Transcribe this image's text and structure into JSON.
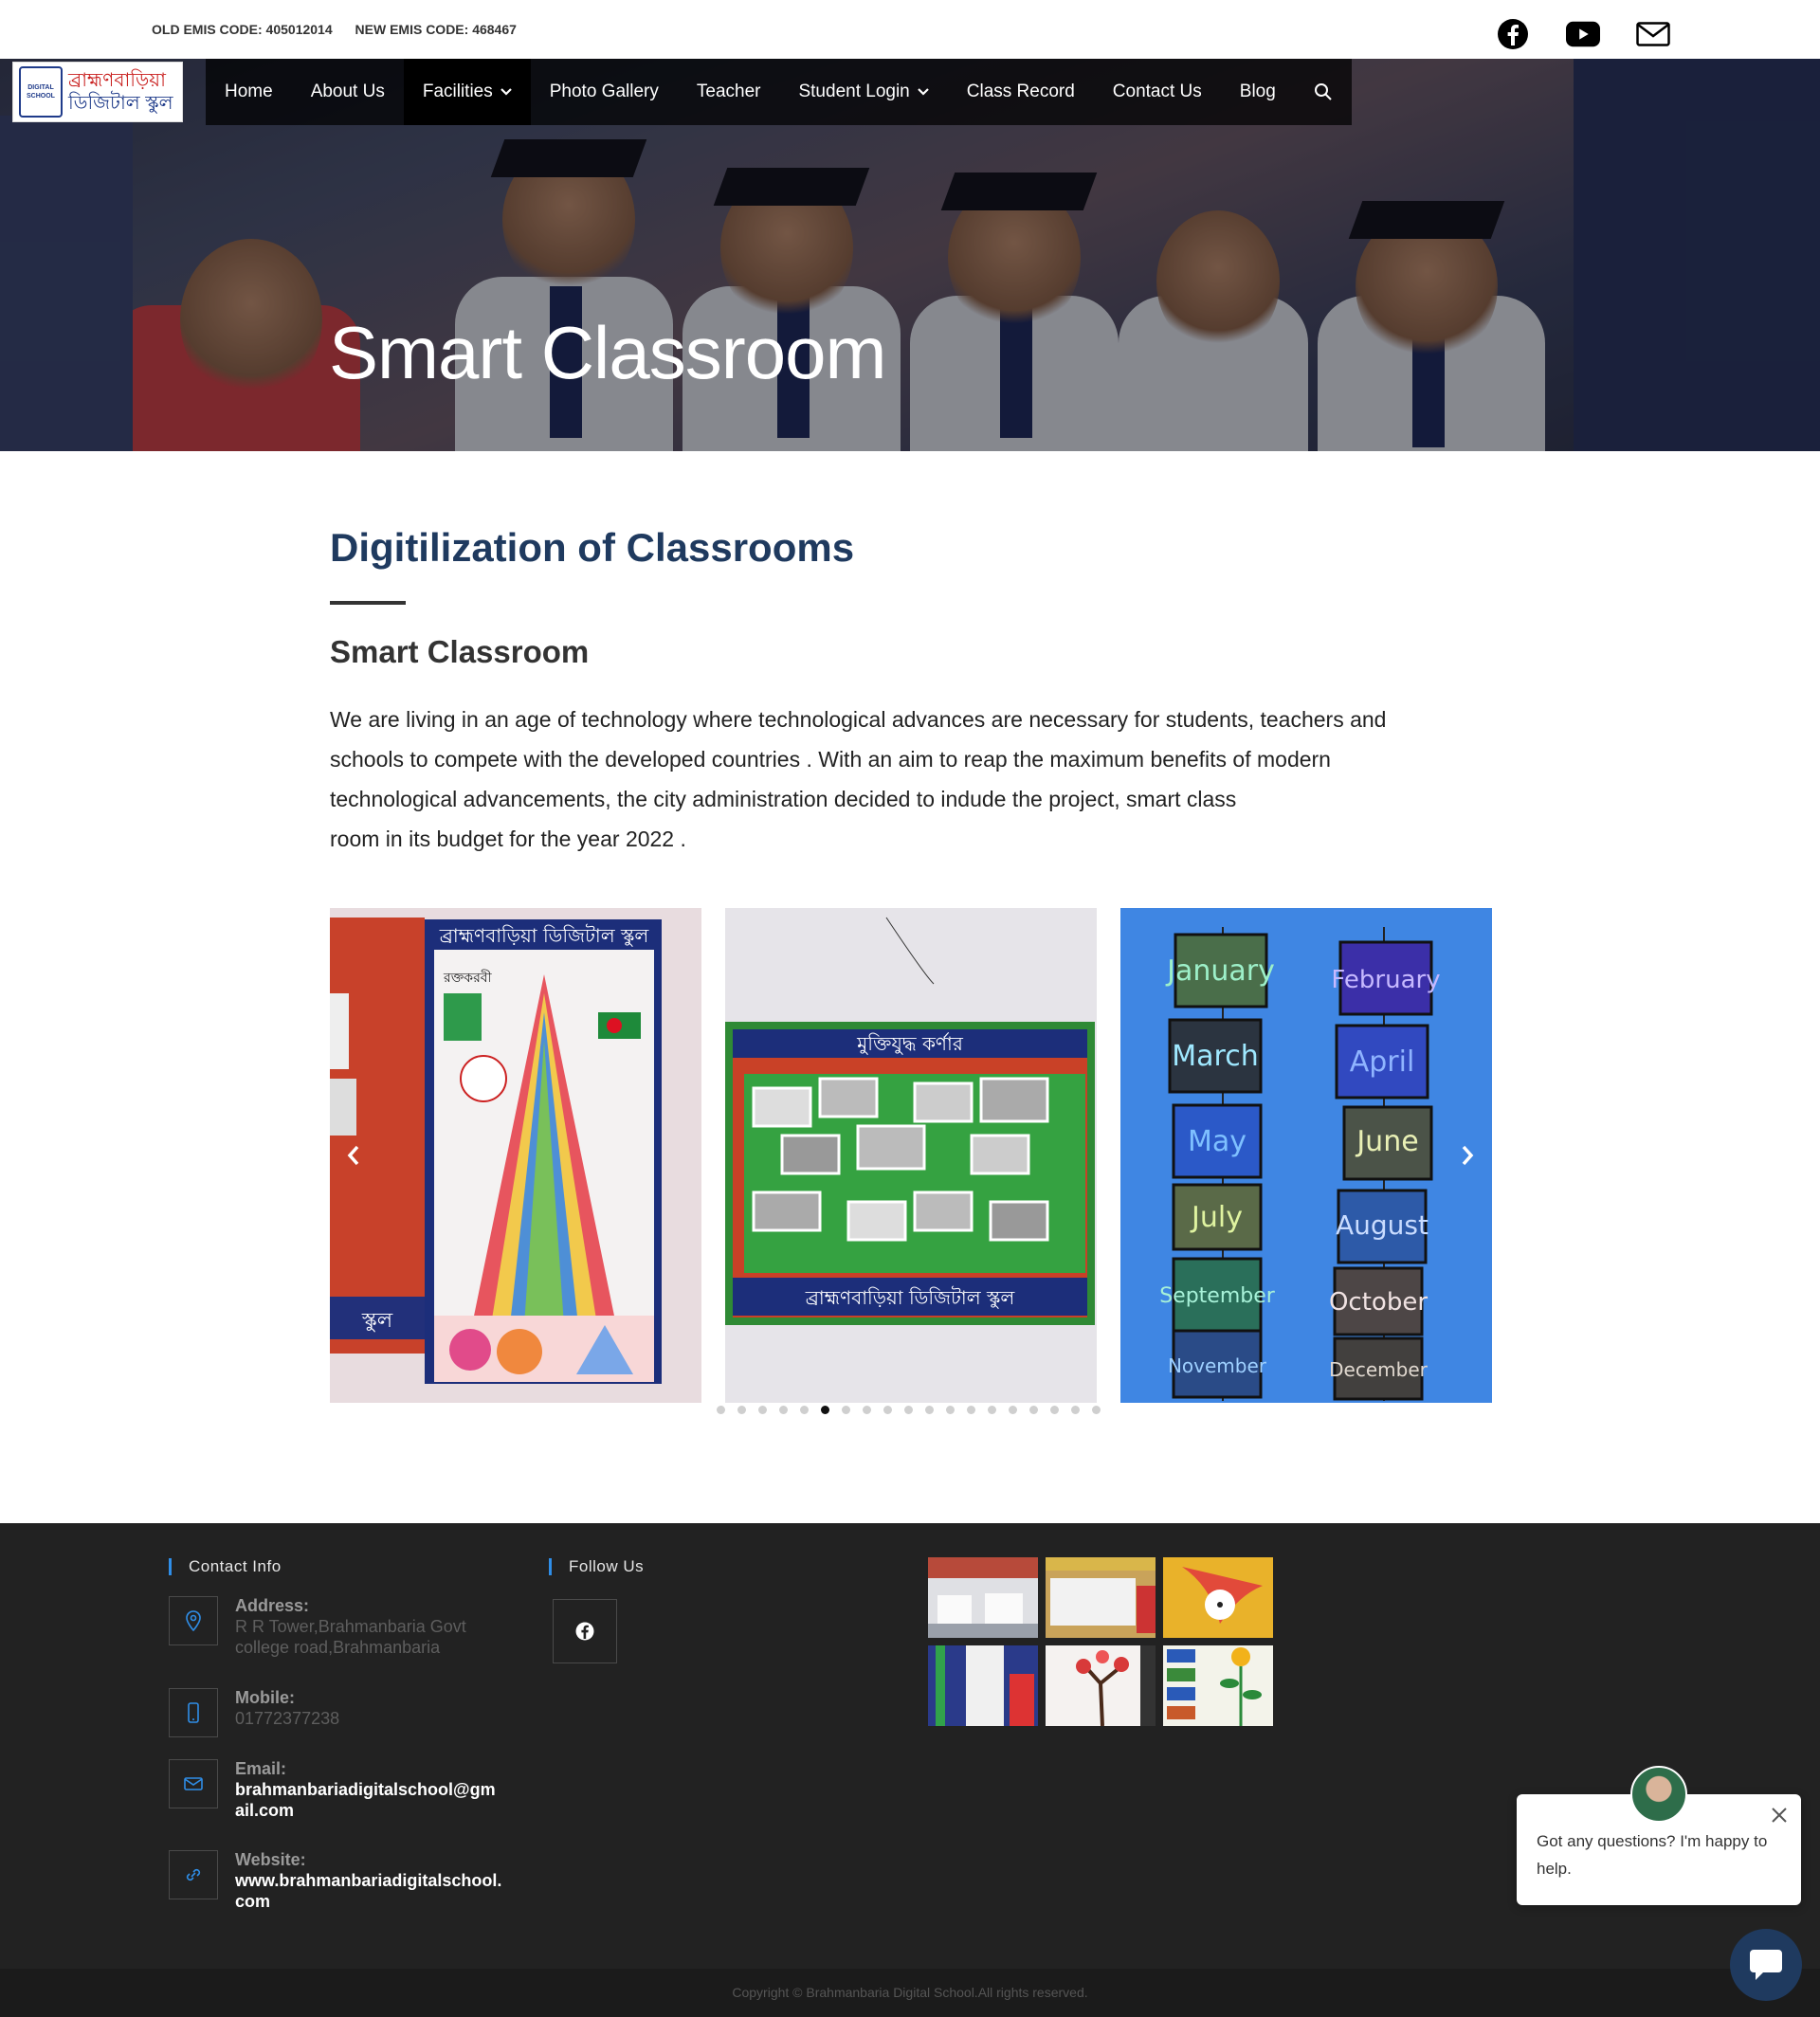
{
  "topbar": {
    "old_emis": "OLD EMIS CODE: 405012014",
    "new_emis": "NEW EMIS CODE: 468467",
    "socials": [
      "facebook-icon",
      "youtube-icon",
      "email-icon"
    ]
  },
  "logo": {
    "seal_text": "DIGITAL SCHOOL",
    "line1": "ব্রাহ্মণবাড়িয়া",
    "line2": "ডিজিটাল স্কুল"
  },
  "nav": {
    "items": [
      {
        "label": "Home"
      },
      {
        "label": "About Us"
      },
      {
        "label": "Facilities"
      },
      {
        "label": "Photo Gallery"
      },
      {
        "label": "Teacher"
      },
      {
        "label": "Student Login"
      },
      {
        "label": "Class Record"
      },
      {
        "label": "Contact Us"
      },
      {
        "label": "Blog"
      }
    ],
    "active": "Facilities",
    "dropdowns": [
      "Facilities",
      "Student Login"
    ]
  },
  "hero": {
    "title": "Smart Classroom"
  },
  "content": {
    "heading": "Digitilization of Classrooms",
    "subheading": "Smart Classroom",
    "paragraph_lines": [
      "We are living in an age of technology where technological advances are necessary for students, teachers and",
      "schools to compete with the developed countries . With an aim to reap the maximum benefits of modern",
      "technological advancements, the city administration decided to indude the project, smart class",
      "room in its budget for the year 2022 ."
    ]
  },
  "slider": {
    "slide1": {
      "banner": "ব্রাহ্মণবাড়িয়া ডিজিটাল স্কুল",
      "corner": "রক্তকরবী",
      "footer": "স্কুল"
    },
    "slide2": {
      "banner": "মুক্তিযুদ্ধ কর্ণার",
      "footer": "ব্রাহ্মণবাড়িয়া ডিজিটাল স্কুল"
    },
    "slide3": {
      "months_left": [
        "January",
        "March",
        "May",
        "July",
        "September",
        "November"
      ],
      "months_right": [
        "February",
        "April",
        "June",
        "August",
        "October",
        "December"
      ]
    },
    "dot_count": 19,
    "active_dot": 5
  },
  "footer": {
    "contact_heading": "Contact Info",
    "follow_heading": "Follow Us",
    "address_label": "Address:",
    "address_line1": "R R Tower,Brahmanbaria Govt",
    "address_line2": "college road,Brahmanbaria",
    "mobile_label": "Mobile:",
    "mobile": "01772377238",
    "email_label": "Email:",
    "email_line1": "brahmanbariadigitalschool@gm",
    "email_line2": "ail.com",
    "website_label": "Website:",
    "website_line1": "www.brahmanbariadigitalschool.",
    "website_line2": "com",
    "copyright": "Copyright © Brahmanbaria Digital School.All rights reserved."
  },
  "chat": {
    "message": "Got any questions? I'm happy to help."
  },
  "colors": {
    "heading": "#1f3a5f",
    "footer_bg": "#222222",
    "accent": "#2f8ee8"
  }
}
